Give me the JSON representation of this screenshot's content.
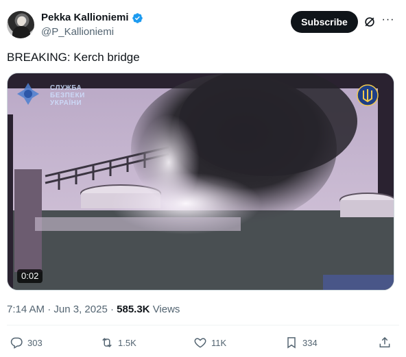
{
  "author": {
    "display_name": "Pekka Kallioniemi",
    "handle": "@P_Kallioniemi",
    "verified": true,
    "verified_color": "#1d9bf0"
  },
  "header": {
    "subscribe_label": "Subscribe",
    "grok_icon": "grok-icon",
    "more_icon": "more-icon"
  },
  "tweet": {
    "text": "BREAKING: Kerch bridge"
  },
  "media": {
    "duration": "0:02",
    "watermark_text_line1": "СЛУЖБА",
    "watermark_text_line2": "БЕЗПЕКИ",
    "watermark_text_line3": "УКРАЇНИ"
  },
  "meta": {
    "time": "7:14 AM",
    "separator": "·",
    "date": "Jun 3, 2025",
    "views_count": "585.3K",
    "views_label": "Views"
  },
  "actions": {
    "replies": "303",
    "reposts": "1.5K",
    "likes": "11K",
    "bookmarks": "334"
  },
  "colors": {
    "text_primary": "#0f1419",
    "text_secondary": "#536471",
    "subscribe_bg": "#0f1419"
  }
}
